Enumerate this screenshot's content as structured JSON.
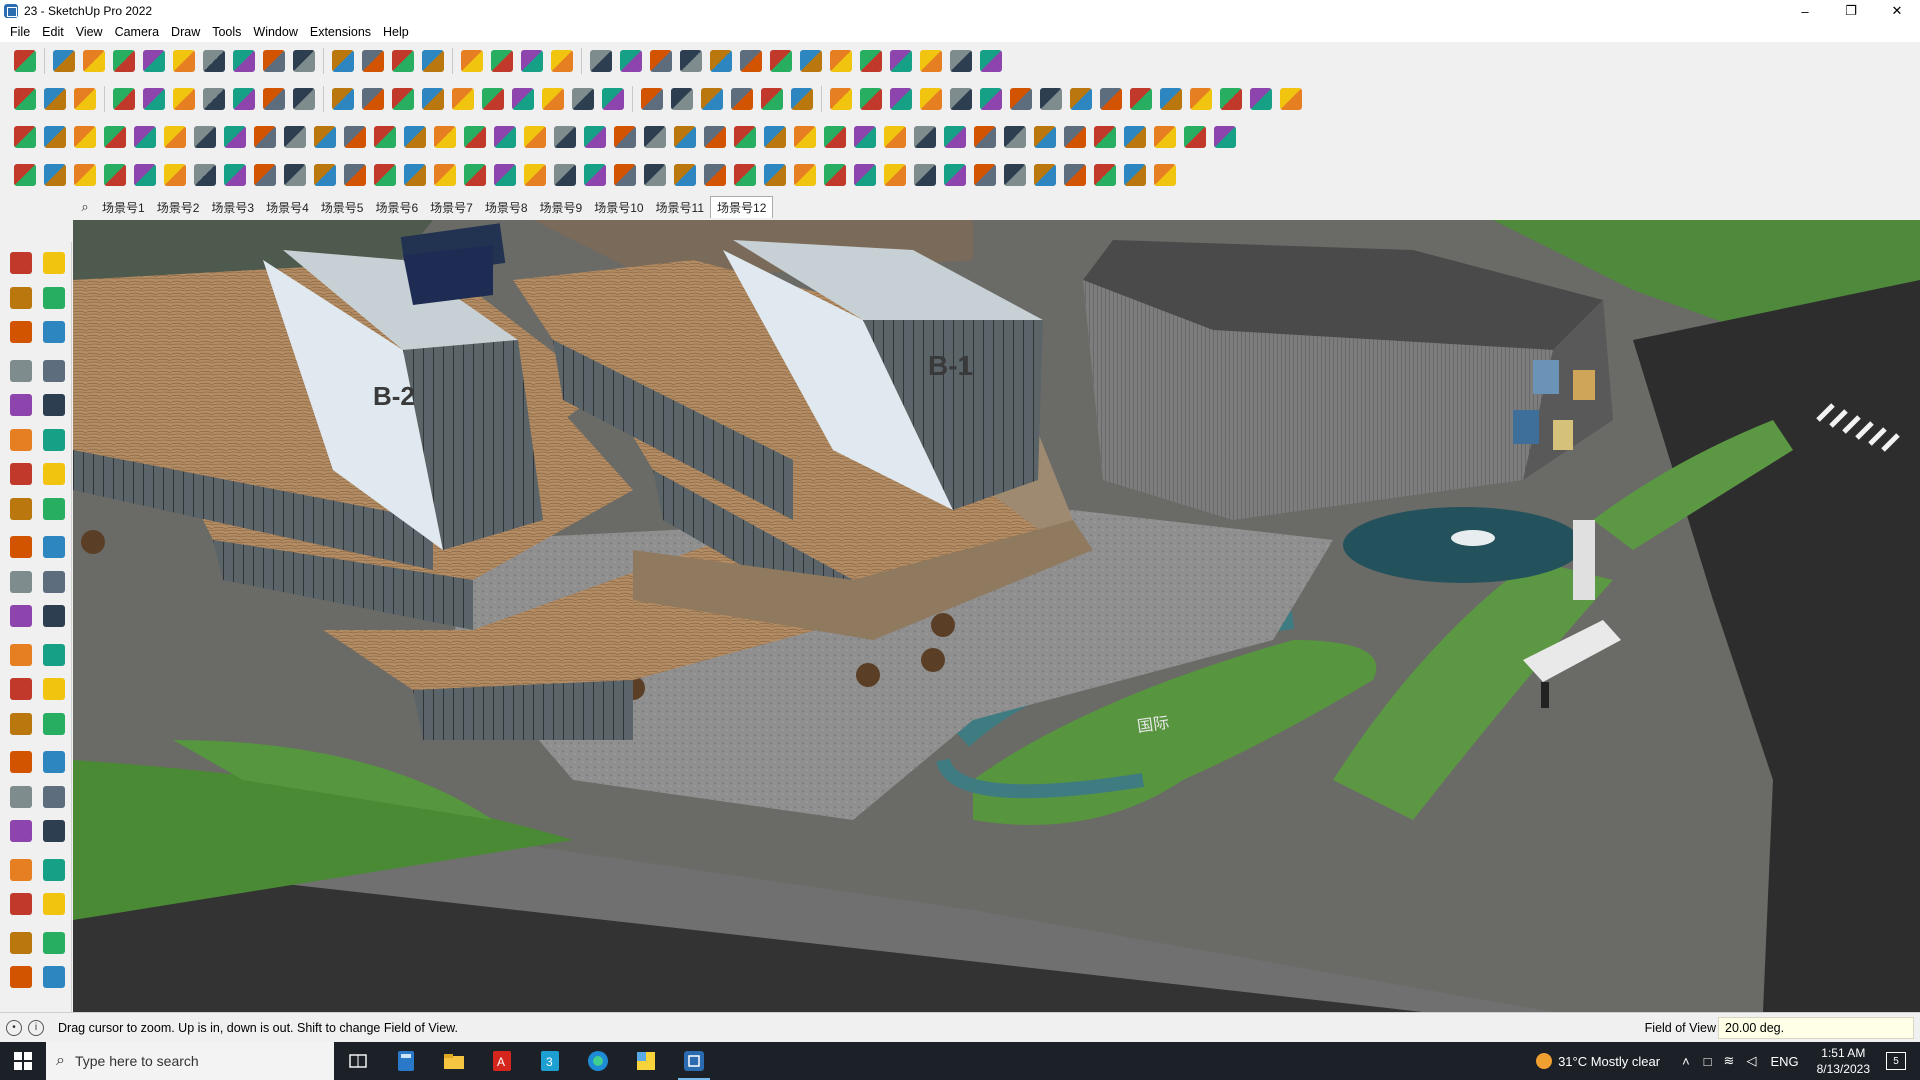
{
  "window": {
    "title": "23 - SketchUp Pro 2022",
    "controls": [
      "minimize-icon",
      "maximize-icon",
      "close-icon"
    ]
  },
  "menu": [
    "File",
    "Edit",
    "View",
    "Camera",
    "Draw",
    "Tools",
    "Window",
    "Extensions",
    "Help"
  ],
  "scenes": {
    "tabs": [
      "场景号1",
      "场景号2",
      "场景号3",
      "场景号4",
      "场景号5",
      "场景号6",
      "场景号7",
      "场景号8",
      "场景号9",
      "场景号10",
      "场景号11",
      "场景号12"
    ],
    "active": "场景号12"
  },
  "viewport": {
    "building_labels": [
      "B-2",
      "B-1"
    ],
    "sign_text": "国际"
  },
  "status": {
    "message": "Drag cursor to zoom.  Up is in, down is out. Shift to change Field of View.",
    "measure_label": "Field of View",
    "measure_value": "20.00 deg."
  },
  "taskbar": {
    "search_placeholder": "Type here to search",
    "weather": "31°C  Mostly clear",
    "language": "ENG",
    "time": "1:51 AM",
    "date": "8/13/2023",
    "notification_count": "5"
  },
  "colors": {
    "toolbar_bg": "#f0f0f0",
    "taskbar_bg": "#1c2128",
    "accent": "#76b9ed",
    "ground": "#6e7b63",
    "roof_deck": "#b08a62",
    "facade": "#dfe9ef",
    "lawn": "#4f8f3a"
  }
}
